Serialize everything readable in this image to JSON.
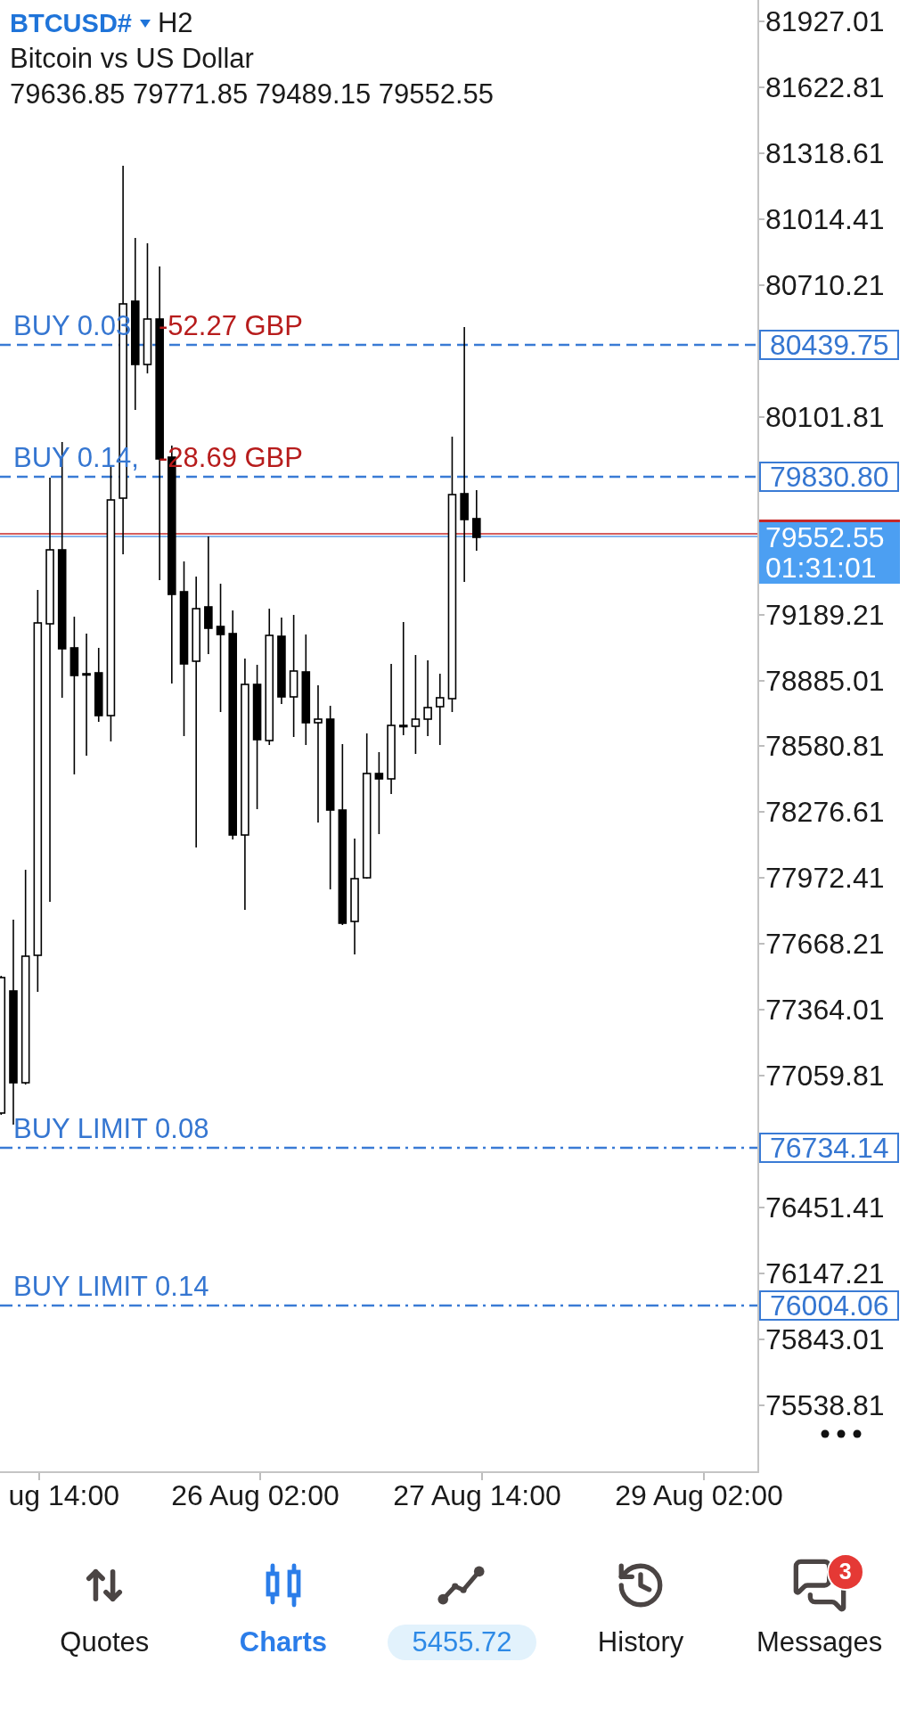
{
  "header": {
    "symbol": "BTCUSD#",
    "timeframe": "H2",
    "description": "Bitcoin vs US Dollar",
    "ohlc": "79636.85 79771.85 79489.15 79552.55"
  },
  "orders": [
    {
      "kind": "position",
      "label": "BUY 0.03",
      "profit": "-52.27 GBP",
      "price": "80439.75"
    },
    {
      "kind": "position",
      "label": "BUY 0.14,",
      "profit": "-28.69 GBP",
      "price": "79830.80"
    },
    {
      "kind": "limit",
      "label": "BUY LIMIT 0.08",
      "price": "76734.14"
    },
    {
      "kind": "limit",
      "label": "BUY LIMIT 0.14",
      "price": "76004.06"
    }
  ],
  "current_price": {
    "price": "79552.55",
    "timer": "01:31:01"
  },
  "price_axis": [
    "81927.01",
    "81622.81",
    "81318.61",
    "81014.41",
    "80710.21",
    "80101.81",
    "79189.21",
    "78885.01",
    "78580.81",
    "78276.61",
    "77972.41",
    "77668.21",
    "77364.01",
    "77059.81",
    "76451.41",
    "76147.21",
    "75843.01",
    "75538.81"
  ],
  "time_axis": [
    "ug 14:00",
    "26 Aug 02:00",
    "27 Aug 14:00",
    "29 Aug 02:00"
  ],
  "nav": [
    {
      "kind": "tab",
      "label": "Quotes",
      "selected": false
    },
    {
      "kind": "tab",
      "label": "Charts",
      "selected": true
    },
    {
      "kind": "pill",
      "label": "5455.72",
      "selected": false
    },
    {
      "kind": "tab",
      "label": "History",
      "selected": false
    },
    {
      "kind": "tab",
      "label": "Messages",
      "selected": false,
      "badge": "3"
    }
  ]
}
